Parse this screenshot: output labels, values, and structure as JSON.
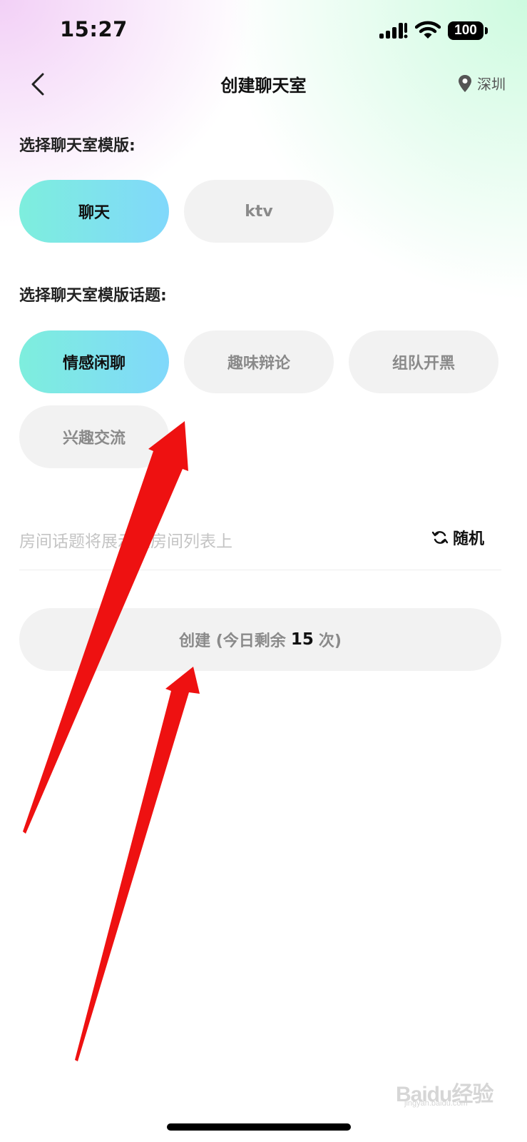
{
  "status_bar": {
    "time": "15:27",
    "battery": "100"
  },
  "nav": {
    "title": "创建聊天室",
    "location": "深圳"
  },
  "template_section": {
    "label": "选择聊天室模版:",
    "options": [
      {
        "label": "聊天",
        "selected": true
      },
      {
        "label": "ktv",
        "selected": false
      }
    ]
  },
  "topic_section": {
    "label": "选择聊天室模版话题:",
    "options": [
      {
        "label": "情感闲聊",
        "selected": true
      },
      {
        "label": "趣味辩论",
        "selected": false
      },
      {
        "label": "组队开黑",
        "selected": false
      },
      {
        "label": "兴趣交流",
        "selected": false
      }
    ]
  },
  "topic_input": {
    "placeholder": "房间话题将展示在房间列表上",
    "random_label": "随机"
  },
  "create": {
    "prefix": "创建 (今日剩余",
    "count": "15",
    "suffix": "次)"
  },
  "watermark": {
    "text": "Baidu经验",
    "sub": "jingyan.baidu.com"
  },
  "colors": {
    "chip_active_start": "#7eeedd",
    "chip_active_end": "#80d8fb",
    "chip_inactive": "#f2f2f2",
    "arrow": "#ee1111"
  }
}
